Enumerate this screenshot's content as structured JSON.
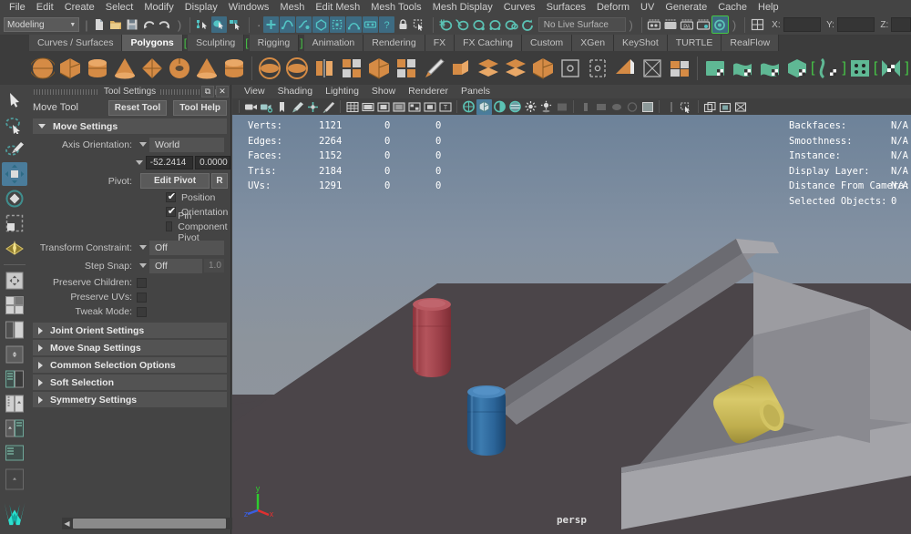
{
  "app": {
    "name": "Autodesk Maya",
    "accent_blue": "#4a7c9b",
    "shelf_orange": "#d58b45",
    "shelf_green": "#5fb894",
    "bracket_green": "#46c846"
  },
  "menubar": {
    "items": [
      {
        "label": "File"
      },
      {
        "label": "Edit"
      },
      {
        "label": "Create"
      },
      {
        "label": "Select"
      },
      {
        "label": "Modify"
      },
      {
        "label": "Display"
      },
      {
        "label": "Windows"
      },
      {
        "label": "Mesh"
      },
      {
        "label": "Edit Mesh"
      },
      {
        "label": "Mesh Tools"
      },
      {
        "label": "Mesh Display"
      },
      {
        "label": "Curves"
      },
      {
        "label": "Surfaces"
      },
      {
        "label": "Deform"
      },
      {
        "label": "UV"
      },
      {
        "label": "Generate"
      },
      {
        "label": "Cache"
      },
      {
        "label": "Help"
      }
    ]
  },
  "statusline": {
    "menuset_value": "Modeling",
    "live_surface_label": "No Live Surface",
    "coord_x_label": "X:",
    "coord_y_label": "Y:",
    "coord_z_label": "Z:",
    "coord_x_value": "",
    "coord_y_value": "",
    "coord_z_value": "",
    "icons": [
      "new-scene-icon",
      "open-scene-icon",
      "save-scene-icon",
      "undo-icon",
      "redo-icon",
      "select-hierarchy-icon",
      "select-object-icon",
      "select-component-icon",
      "snap-grid-icon",
      "snap-curve-icon",
      "snap-point-icon",
      "snap-projected-center-icon",
      "snap-view-plane-icon",
      "make-live-icon",
      "lock-icon",
      "select-by-name-icon",
      "render-current-frame-icon",
      "ipr-render-icon",
      "render-settings-icon",
      "hypershade-icon",
      "render-view-icon",
      "numeric-input-icon"
    ]
  },
  "shelf": {
    "tabs": [
      {
        "label": "Curves / Surfaces",
        "active": false,
        "bracket_before": false,
        "bracket_after": false
      },
      {
        "label": "Polygons",
        "active": true,
        "bracket_before": false,
        "bracket_after": false
      },
      {
        "label": "Sculpting",
        "active": false,
        "bracket_before": true,
        "bracket_after": false
      },
      {
        "label": "Rigging",
        "active": false,
        "bracket_before": true,
        "bracket_after": true
      },
      {
        "label": "Animation",
        "active": false,
        "bracket_before": false,
        "bracket_after": false
      },
      {
        "label": "Rendering",
        "active": false,
        "bracket_before": false,
        "bracket_after": false
      },
      {
        "label": "FX",
        "active": false,
        "bracket_before": false,
        "bracket_after": false
      },
      {
        "label": "FX Caching",
        "active": false,
        "bracket_before": false,
        "bracket_after": false
      },
      {
        "label": "Custom",
        "active": false,
        "bracket_before": false,
        "bracket_after": false
      },
      {
        "label": "XGen",
        "active": false,
        "bracket_before": false,
        "bracket_after": false
      },
      {
        "label": "KeyShot",
        "active": false,
        "bracket_before": false,
        "bracket_after": false
      },
      {
        "label": "TURTLE",
        "active": false,
        "bracket_before": false,
        "bracket_after": false
      },
      {
        "label": "RealFlow",
        "active": false,
        "bracket_before": false,
        "bracket_after": false
      }
    ],
    "buttons": [
      {
        "name": "poly-sphere-icon",
        "kind": "sphere",
        "color": "#d58b45"
      },
      {
        "name": "poly-cube-icon",
        "kind": "cube",
        "color": "#d58b45"
      },
      {
        "name": "poly-cylinder-icon",
        "kind": "cylinder",
        "color": "#d58b45"
      },
      {
        "name": "poly-cone-icon",
        "kind": "cone",
        "color": "#d58b45"
      },
      {
        "name": "poly-plane-icon",
        "kind": "diamond",
        "color": "#d58b45"
      },
      {
        "name": "poly-torus-icon",
        "kind": "torus",
        "color": "#d58b45"
      },
      {
        "name": "poly-prism-icon",
        "kind": "cone",
        "color": "#d58b45"
      },
      {
        "name": "poly-pipe-icon",
        "kind": "cylinder",
        "color": "#d58b45"
      },
      {
        "name": "sep",
        "kind": "sep"
      },
      {
        "name": "combine-icon",
        "kind": "disc",
        "color": "#d58b45"
      },
      {
        "name": "separate-icon",
        "kind": "disc",
        "color": "#d58b45"
      },
      {
        "name": "mirror-geometry-icon",
        "kind": "mirror",
        "color": "#d58b45"
      },
      {
        "name": "smooth-icon",
        "kind": "grid",
        "color": "#d58b45"
      },
      {
        "name": "boolean-icon",
        "kind": "cube",
        "color": "#d58b45"
      },
      {
        "name": "bevel-icon",
        "kind": "grid",
        "color": "#d58b45"
      },
      {
        "name": "multi-cut-icon",
        "kind": "knife",
        "color": "#d58b45"
      },
      {
        "name": "extrude-icon",
        "kind": "extrude",
        "color": "#d58b45"
      },
      {
        "name": "wedge-icon",
        "kind": "layers",
        "color": "#d58b45"
      },
      {
        "name": "duplicate-face-icon",
        "kind": "layers",
        "color": "#d58b45"
      },
      {
        "name": "poly-cube-2-icon",
        "kind": "cube",
        "color": "#d58b45"
      },
      {
        "name": "center-pivot-icon",
        "kind": "outline-square",
        "color": "#b9b9b9"
      },
      {
        "name": "transform-handle-icon",
        "kind": "outline-brackets",
        "color": "#b9b9b9"
      },
      {
        "name": "snap-align-icon",
        "kind": "fold",
        "color": "#d58b45"
      },
      {
        "name": "uv-planar-icon",
        "kind": "outline-x",
        "color": "#b9b9b9"
      },
      {
        "name": "uv-editor-icon",
        "kind": "checker",
        "color": "#d58b45"
      },
      {
        "name": "sep2",
        "kind": "sep"
      },
      {
        "name": "sculpt-plane-icon",
        "kind": "greenplane",
        "color": "#5fb894"
      },
      {
        "name": "sculpt-curve-icon",
        "kind": "greenwave",
        "color": "#5fb894"
      },
      {
        "name": "sculpt-wave-icon",
        "kind": "greenwave",
        "color": "#5fb894"
      },
      {
        "name": "sculpt-cube-icon",
        "kind": "greencube",
        "color": "#5fb894"
      },
      {
        "name": "sculpt-flow-icon",
        "kind": "greenflow",
        "color": "#5fb894",
        "bracket": true
      },
      {
        "name": "sculpt-grid-icon",
        "kind": "greengrid",
        "color": "#5fb894"
      },
      {
        "name": "sculpt-symmetry-icon",
        "kind": "greensym",
        "color": "#5fb894",
        "bracket": true
      }
    ]
  },
  "toolbox": {
    "items": [
      {
        "name": "select-tool",
        "icon": "arrow-cursor-icon",
        "active": false
      },
      {
        "name": "lasso-select-tool",
        "icon": "lasso-select-icon",
        "active": false
      },
      {
        "name": "paint-select-tool",
        "icon": "paint-brush-icon",
        "active": false
      },
      {
        "name": "move-tool",
        "icon": "move-arrows-icon",
        "active": true
      },
      {
        "name": "rotate-tool",
        "icon": "rotate-ring-icon",
        "active": false
      },
      {
        "name": "scale-tool",
        "icon": "scale-box-icon",
        "active": false
      },
      {
        "name": "last-tool",
        "icon": "multi-cut-tool-icon",
        "active": false
      },
      {
        "name": "divider",
        "icon": "divider",
        "active": false
      },
      {
        "name": "single-view-layout",
        "icon": "single-pane-icon",
        "active": false
      },
      {
        "name": "four-view-layout",
        "icon": "four-pane-icon",
        "active": false
      },
      {
        "name": "two-pane-side-layout",
        "icon": "two-pane-side-icon",
        "active": false
      },
      {
        "name": "persp-outliner-layout",
        "icon": "persp-outliner-icon",
        "active": false
      },
      {
        "name": "persp-graph-layout",
        "icon": "persp-graph-icon",
        "active": false
      },
      {
        "name": "hypershade-layout",
        "icon": "hypershade-layout-icon",
        "active": false
      },
      {
        "name": "persp-hypershade-layout",
        "icon": "persp-hyper-icon",
        "active": false
      },
      {
        "name": "outliner-persp-layout",
        "icon": "outliner-persp-icon",
        "active": false
      },
      {
        "name": "empty-layout",
        "icon": "empty-pane-icon",
        "active": false
      },
      {
        "name": "maya-logo",
        "icon": "maya-logo-icon",
        "active": false
      }
    ]
  },
  "tool_settings": {
    "window_title": "Tool Settings",
    "tool_name": "Move Tool",
    "reset_button": "Reset Tool",
    "help_button": "Tool Help",
    "sections": [
      {
        "label": "Move Settings",
        "expanded": true
      },
      {
        "label": "Joint Orient Settings",
        "expanded": false
      },
      {
        "label": "Move Snap Settings",
        "expanded": false
      },
      {
        "label": "Common Selection Options",
        "expanded": false
      },
      {
        "label": "Soft Selection",
        "expanded": false
      },
      {
        "label": "Symmetry Settings",
        "expanded": false
      }
    ],
    "axis_orientation_label": "Axis Orientation:",
    "axis_orientation_value": "World",
    "axis_num_1": "-52.2414",
    "axis_num_2": "0.0000",
    "pivot_label": "Pivot:",
    "pivot_edit_button": "Edit Pivot",
    "pivot_reset_button": "R",
    "pivot_position_label": "Position",
    "pivot_position_checked": true,
    "pivot_orientation_label": "Orientation",
    "pivot_orientation_checked": true,
    "pin_component_pivot_label": "Pin Component Pivot",
    "pin_component_pivot_checked": false,
    "transform_constraint_label": "Transform Constraint:",
    "transform_constraint_value": "Off",
    "step_snap_label": "Step Snap:",
    "step_snap_value": "Off",
    "step_snap_amount": "1.0",
    "preserve_children_label": "Preserve Children:",
    "preserve_uvs_label": "Preserve UVs:",
    "tweak_mode_label": "Tweak Mode:"
  },
  "viewport": {
    "menus": [
      {
        "label": "View"
      },
      {
        "label": "Shading"
      },
      {
        "label": "Lighting"
      },
      {
        "label": "Show"
      },
      {
        "label": "Renderer"
      },
      {
        "label": "Panels"
      }
    ],
    "toolbar_icons": [
      "camera-select-icon",
      "camera-attributes-icon",
      "bookmark-icon",
      "image-plane-icon",
      "2d-pan-zoom-icon",
      "grease-pencil-icon",
      "grid-toggle-icon",
      "film-gate-icon",
      "resolution-gate-icon",
      "gate-mask-icon",
      "field-chart-icon",
      "safe-action-icon",
      "safe-title-icon",
      "wireframe-shading-icon",
      "smooth-shade-all-icon",
      "shaded-wireframe-icon",
      "textured-icon",
      "use-all-lights-icon",
      "shadows-icon",
      "screen-space-ao-icon",
      "motion-blur-icon",
      "multisample-icon",
      "depth-of-field-icon",
      "isolate-select-icon",
      "xray-icon",
      "xray-joints-icon",
      "xray-active-components-icon",
      "exposure-icon",
      "gamma-icon",
      "view-transform-icon"
    ],
    "camera_label": "persp",
    "axis_gizmo": {
      "x_label": "x",
      "y_label": "y",
      "z_label": "z"
    },
    "hud_left": {
      "columns": 3,
      "rows": [
        {
          "label": "Verts:",
          "v1": "1121",
          "v2": "0",
          "v3": "0"
        },
        {
          "label": "Edges:",
          "v1": "2264",
          "v2": "0",
          "v3": "0"
        },
        {
          "label": "Faces:",
          "v1": "1152",
          "v2": "0",
          "v3": "0"
        },
        {
          "label": "Tris:",
          "v1": "2184",
          "v2": "0",
          "v3": "0"
        },
        {
          "label": "UVs:",
          "v1": "1291",
          "v2": "0",
          "v3": "0"
        }
      ]
    },
    "hud_right": {
      "rows": [
        {
          "label": "Backfaces:",
          "value": "N/A"
        },
        {
          "label": "Smoothness:",
          "value": "N/A"
        },
        {
          "label": "Instance:",
          "value": "N/A"
        },
        {
          "label": "Display Layer:",
          "value": "N/A"
        },
        {
          "label": "Distance From Camera:",
          "value": "N/A"
        },
        {
          "label": "Selected Objects:",
          "value": "0"
        }
      ]
    },
    "scene": {
      "description": "Grey ramp / wedge platform with three capsule cylinders",
      "objects": [
        {
          "name": "red-capsule",
          "color": "#a8434a"
        },
        {
          "name": "blue-capsule",
          "color": "#2f6196"
        },
        {
          "name": "yellow-capsule",
          "color": "#c7b352"
        },
        {
          "name": "grey-ramp",
          "color": "#8b8b90"
        },
        {
          "name": "ground-plane",
          "color": "#4a4549"
        }
      ]
    }
  }
}
